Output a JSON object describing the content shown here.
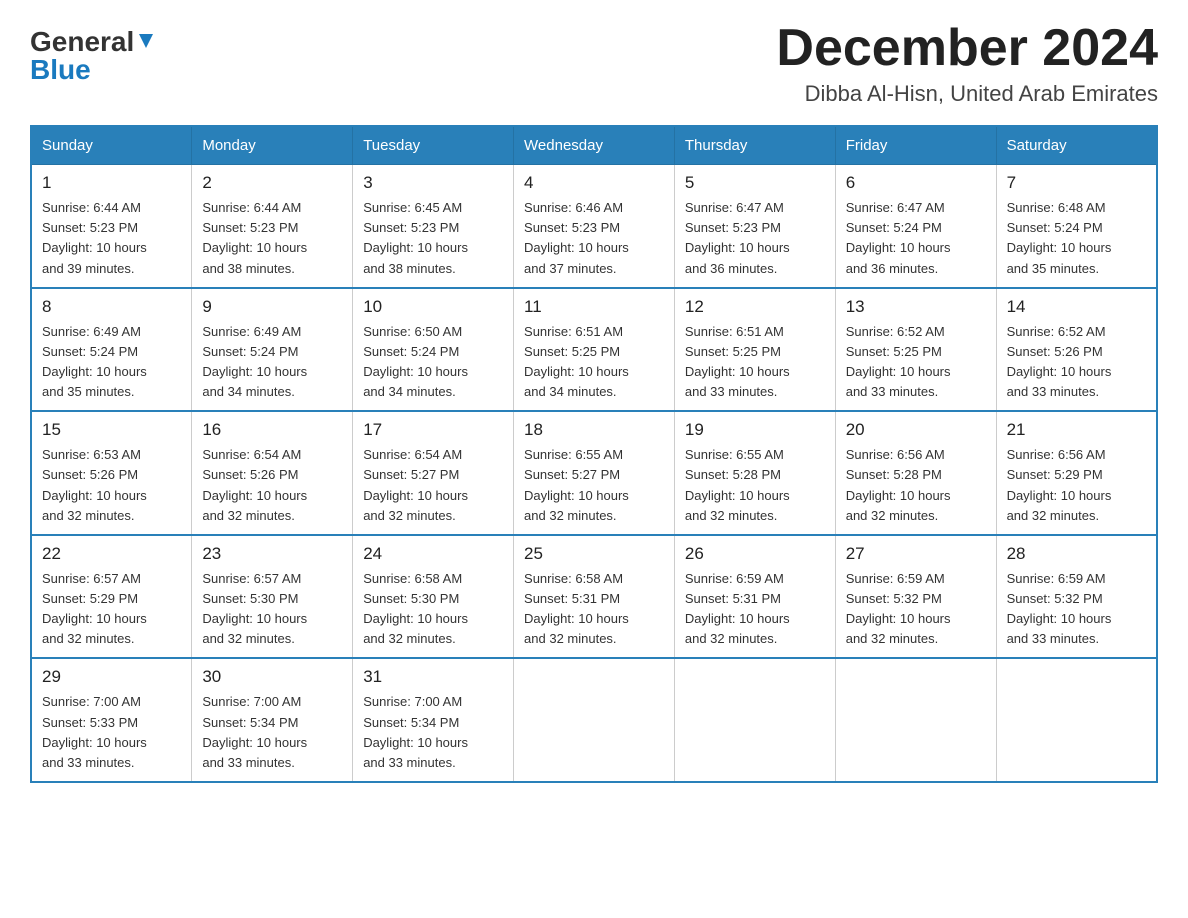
{
  "logo": {
    "general": "General",
    "blue": "Blue"
  },
  "title": {
    "month": "December 2024",
    "location": "Dibba Al-Hisn, United Arab Emirates"
  },
  "headers": [
    "Sunday",
    "Monday",
    "Tuesday",
    "Wednesday",
    "Thursday",
    "Friday",
    "Saturday"
  ],
  "weeks": [
    [
      {
        "day": "1",
        "sunrise": "6:44 AM",
        "sunset": "5:23 PM",
        "daylight": "10 hours and 39 minutes."
      },
      {
        "day": "2",
        "sunrise": "6:44 AM",
        "sunset": "5:23 PM",
        "daylight": "10 hours and 38 minutes."
      },
      {
        "day": "3",
        "sunrise": "6:45 AM",
        "sunset": "5:23 PM",
        "daylight": "10 hours and 38 minutes."
      },
      {
        "day": "4",
        "sunrise": "6:46 AM",
        "sunset": "5:23 PM",
        "daylight": "10 hours and 37 minutes."
      },
      {
        "day": "5",
        "sunrise": "6:47 AM",
        "sunset": "5:23 PM",
        "daylight": "10 hours and 36 minutes."
      },
      {
        "day": "6",
        "sunrise": "6:47 AM",
        "sunset": "5:24 PM",
        "daylight": "10 hours and 36 minutes."
      },
      {
        "day": "7",
        "sunrise": "6:48 AM",
        "sunset": "5:24 PM",
        "daylight": "10 hours and 35 minutes."
      }
    ],
    [
      {
        "day": "8",
        "sunrise": "6:49 AM",
        "sunset": "5:24 PM",
        "daylight": "10 hours and 35 minutes."
      },
      {
        "day": "9",
        "sunrise": "6:49 AM",
        "sunset": "5:24 PM",
        "daylight": "10 hours and 34 minutes."
      },
      {
        "day": "10",
        "sunrise": "6:50 AM",
        "sunset": "5:24 PM",
        "daylight": "10 hours and 34 minutes."
      },
      {
        "day": "11",
        "sunrise": "6:51 AM",
        "sunset": "5:25 PM",
        "daylight": "10 hours and 34 minutes."
      },
      {
        "day": "12",
        "sunrise": "6:51 AM",
        "sunset": "5:25 PM",
        "daylight": "10 hours and 33 minutes."
      },
      {
        "day": "13",
        "sunrise": "6:52 AM",
        "sunset": "5:25 PM",
        "daylight": "10 hours and 33 minutes."
      },
      {
        "day": "14",
        "sunrise": "6:52 AM",
        "sunset": "5:26 PM",
        "daylight": "10 hours and 33 minutes."
      }
    ],
    [
      {
        "day": "15",
        "sunrise": "6:53 AM",
        "sunset": "5:26 PM",
        "daylight": "10 hours and 32 minutes."
      },
      {
        "day": "16",
        "sunrise": "6:54 AM",
        "sunset": "5:26 PM",
        "daylight": "10 hours and 32 minutes."
      },
      {
        "day": "17",
        "sunrise": "6:54 AM",
        "sunset": "5:27 PM",
        "daylight": "10 hours and 32 minutes."
      },
      {
        "day": "18",
        "sunrise": "6:55 AM",
        "sunset": "5:27 PM",
        "daylight": "10 hours and 32 minutes."
      },
      {
        "day": "19",
        "sunrise": "6:55 AM",
        "sunset": "5:28 PM",
        "daylight": "10 hours and 32 minutes."
      },
      {
        "day": "20",
        "sunrise": "6:56 AM",
        "sunset": "5:28 PM",
        "daylight": "10 hours and 32 minutes."
      },
      {
        "day": "21",
        "sunrise": "6:56 AM",
        "sunset": "5:29 PM",
        "daylight": "10 hours and 32 minutes."
      }
    ],
    [
      {
        "day": "22",
        "sunrise": "6:57 AM",
        "sunset": "5:29 PM",
        "daylight": "10 hours and 32 minutes."
      },
      {
        "day": "23",
        "sunrise": "6:57 AM",
        "sunset": "5:30 PM",
        "daylight": "10 hours and 32 minutes."
      },
      {
        "day": "24",
        "sunrise": "6:58 AM",
        "sunset": "5:30 PM",
        "daylight": "10 hours and 32 minutes."
      },
      {
        "day": "25",
        "sunrise": "6:58 AM",
        "sunset": "5:31 PM",
        "daylight": "10 hours and 32 minutes."
      },
      {
        "day": "26",
        "sunrise": "6:59 AM",
        "sunset": "5:31 PM",
        "daylight": "10 hours and 32 minutes."
      },
      {
        "day": "27",
        "sunrise": "6:59 AM",
        "sunset": "5:32 PM",
        "daylight": "10 hours and 32 minutes."
      },
      {
        "day": "28",
        "sunrise": "6:59 AM",
        "sunset": "5:32 PM",
        "daylight": "10 hours and 33 minutes."
      }
    ],
    [
      {
        "day": "29",
        "sunrise": "7:00 AM",
        "sunset": "5:33 PM",
        "daylight": "10 hours and 33 minutes."
      },
      {
        "day": "30",
        "sunrise": "7:00 AM",
        "sunset": "5:34 PM",
        "daylight": "10 hours and 33 minutes."
      },
      {
        "day": "31",
        "sunrise": "7:00 AM",
        "sunset": "5:34 PM",
        "daylight": "10 hours and 33 minutes."
      },
      null,
      null,
      null,
      null
    ]
  ],
  "labels": {
    "sunrise": "Sunrise:",
    "sunset": "Sunset:",
    "daylight": "Daylight:"
  }
}
